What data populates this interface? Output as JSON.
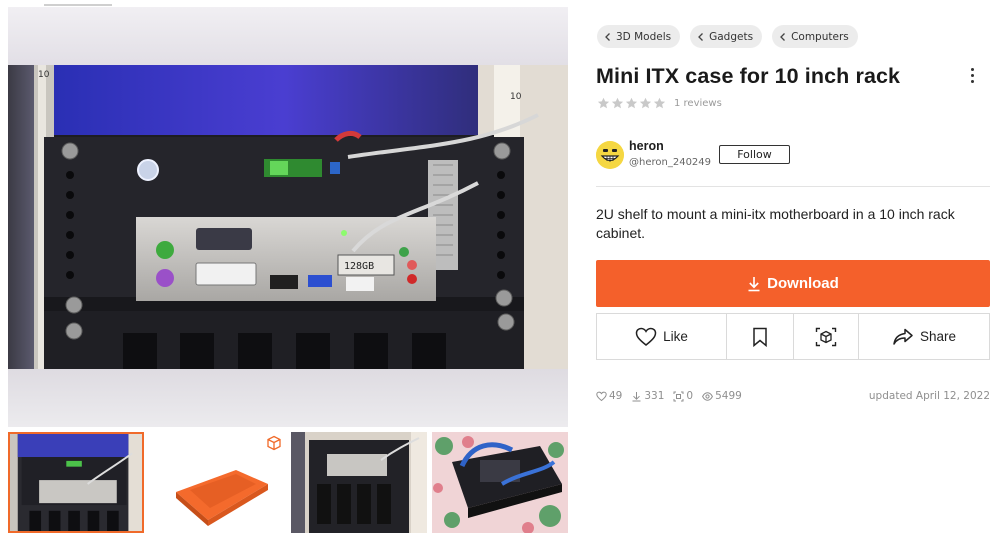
{
  "breadcrumbs": [
    "3D Models",
    "Gadgets",
    "Computers"
  ],
  "title": "Mini ITX case for 10 inch rack",
  "rating": {
    "stars": 0,
    "max": 5,
    "reviews_label": "1 reviews"
  },
  "author": {
    "name": "heron",
    "handle": "@heron_240249",
    "follow_label": "Follow"
  },
  "description": "2U shelf to mount a mini-itx motherboard in a 10 inch rack cabinet.",
  "download_label": "Download",
  "actions": {
    "like": "Like",
    "share": "Share"
  },
  "stats": {
    "likes": "49",
    "downloads": "331",
    "makes": "0",
    "views": "5499",
    "updated": "updated April 12, 2022"
  },
  "photo_labels": {
    "ram_tag": "128GB",
    "rack_number_top": "10",
    "rack_number_right": "10"
  },
  "colors": {
    "accent": "#f4602b",
    "thumb_selected": "#f06a2a",
    "crumb_bg": "#ececec",
    "text_muted": "#8f8f8f"
  },
  "icons": [
    "chevron-left-icon",
    "kebab-menu-icon",
    "star-icon",
    "download-arrow-icon",
    "heart-icon",
    "bookmark-icon",
    "ar-view-icon",
    "share-icon",
    "stat-heart-icon",
    "stat-download-icon",
    "stat-makes-icon",
    "stat-eye-icon",
    "cube-3d-icon"
  ]
}
